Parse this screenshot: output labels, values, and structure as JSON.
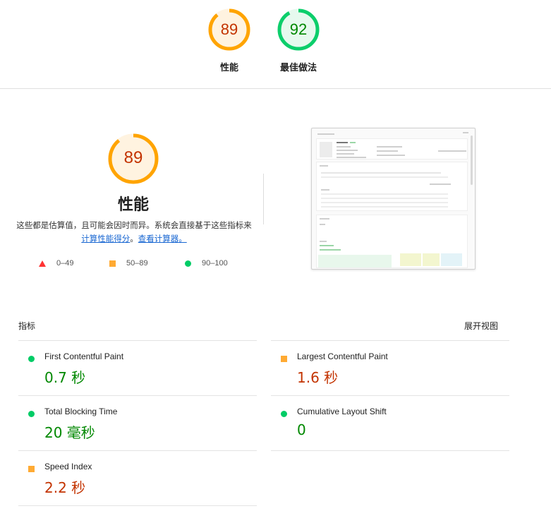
{
  "top_gauges": [
    {
      "score": "89",
      "label": "性能",
      "level": "average"
    },
    {
      "score": "92",
      "label": "最佳做法",
      "level": "pass"
    }
  ],
  "performance": {
    "score": "89",
    "title": "性能",
    "desc_text": "这些都是估算值，且可能会因时而异。系统会直接基于这些指标来",
    "link_calc": "计算性能得分",
    "desc_sep": "。",
    "link_calculator": "查看计算器。"
  },
  "legend": [
    {
      "range": "0–49",
      "shape": "triangle",
      "color": "#ff3333"
    },
    {
      "range": "50–89",
      "shape": "square",
      "color": "#ffaa33"
    },
    {
      "range": "90–100",
      "shape": "circle",
      "color": "#00cc66"
    }
  ],
  "metrics_section": {
    "heading": "指标",
    "expand_label": "展开视图"
  },
  "metrics": [
    {
      "name": "First Contentful Paint",
      "value": "0.7 秒",
      "level": "pass"
    },
    {
      "name": "Largest Contentful Paint",
      "value": "1.6 秒",
      "level": "average"
    },
    {
      "name": "Total Blocking Time",
      "value": "20 毫秒",
      "level": "pass"
    },
    {
      "name": "Cumulative Layout Shift",
      "value": "0",
      "level": "pass"
    },
    {
      "name": "Speed Index",
      "value": "2.2 秒",
      "level": "average"
    }
  ],
  "colors": {
    "average": "#ffa400",
    "average_text": "#c33300",
    "average_fill": "#fff3e0",
    "pass": "#0cce6b",
    "pass_text": "#008800",
    "pass_fill": "#e6f9ee"
  }
}
